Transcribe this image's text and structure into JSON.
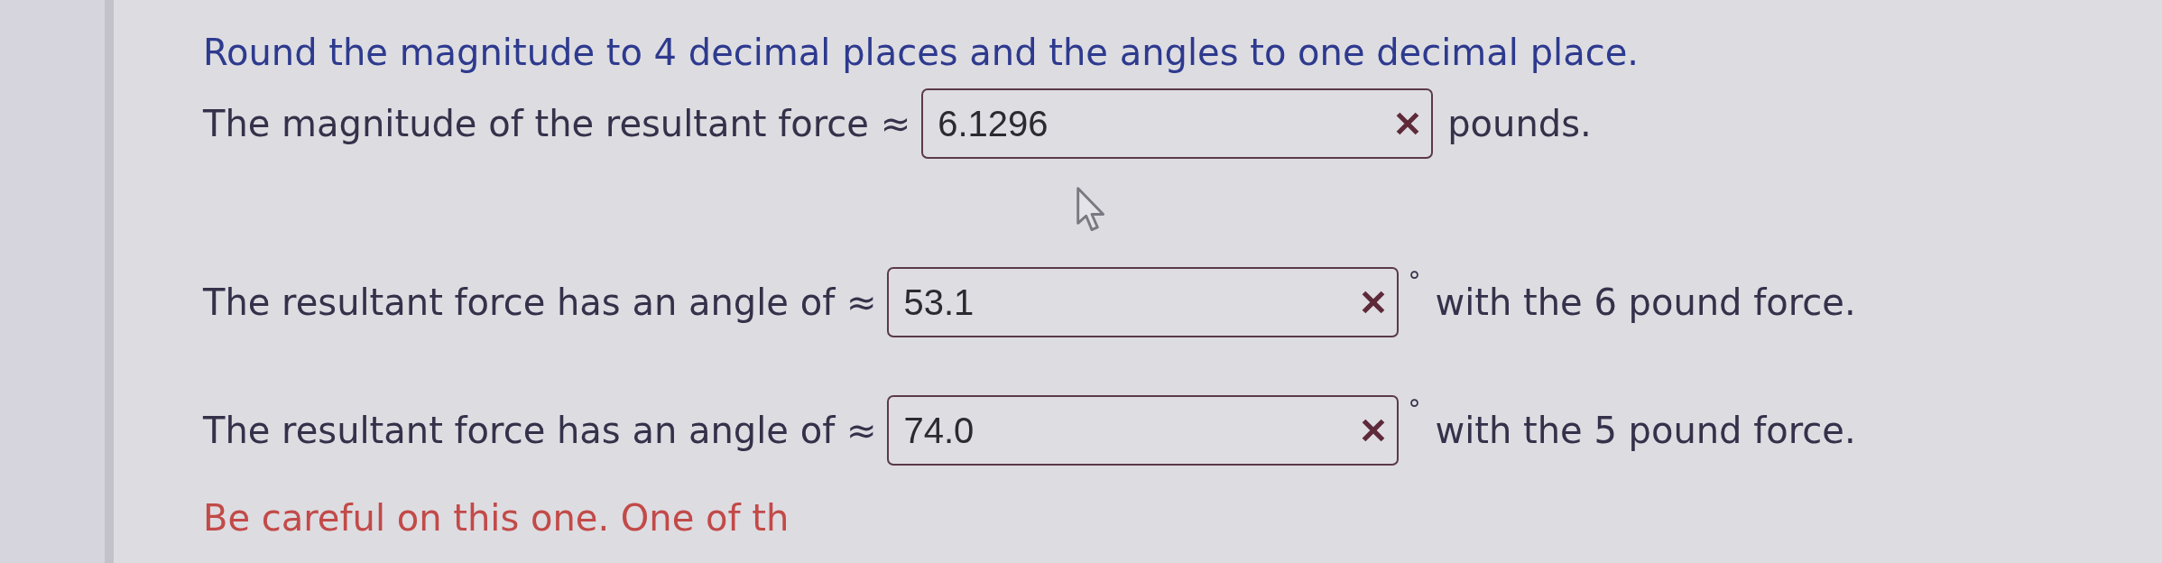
{
  "instructions": "Round the magnitude to 4 decimal places and the angles to one decimal place.",
  "questions": [
    {
      "kind": "magnitude",
      "prompt": "The magnitude of the resultant force ≈",
      "value": "6.1296",
      "incorrect": true,
      "unit": "pounds."
    },
    {
      "kind": "angle",
      "prompt": "The resultant force has an angle of ≈",
      "value": "53.1",
      "incorrect": true,
      "degree": "°",
      "unit": "with the 6 pound force."
    },
    {
      "kind": "angle",
      "prompt": "The resultant force has an angle of ≈",
      "value": "74.0",
      "incorrect": true,
      "degree": "°",
      "unit": "with the 5 pound force."
    }
  ],
  "hint": "Be careful on this one. One of th"
}
